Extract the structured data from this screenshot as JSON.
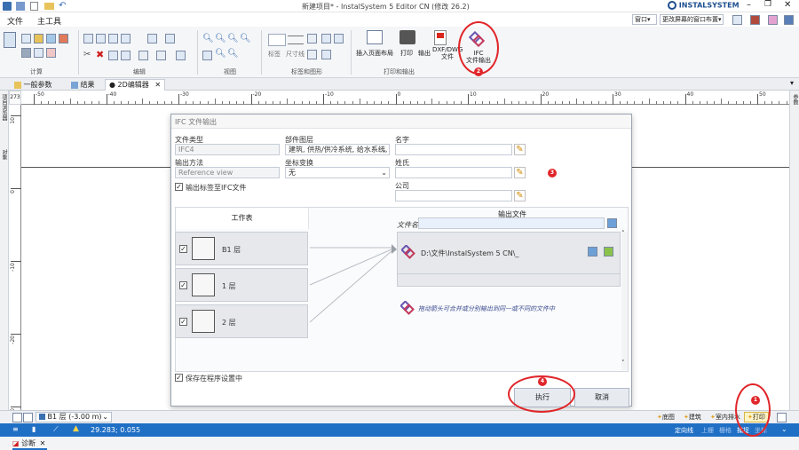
{
  "window": {
    "title": "新建项目* - InstalSystem 5 Editor CN (修改 26.2)",
    "brand": "INSTALSYSTEM"
  },
  "menu": {
    "file": "文件",
    "main_tools": "主工具"
  },
  "top_right": {
    "window": "窗口",
    "change_layout": "更改屏幕的窗口布置"
  },
  "ribbon": {
    "group_calc": "计算",
    "group_edit": "编辑",
    "group_view": "视图",
    "group_annotations": "标签和图形",
    "group_print": "打印和输出",
    "labels": "标签",
    "dims": "尺寸线",
    "insert_layout": "插入页面布局",
    "print": "打印",
    "output": "输出",
    "dxf_line1": "DXF/DWG",
    "dxf_line2": "文件",
    "ifc_line1": "IFC",
    "ifc_line2": "文件输出"
  },
  "doc_tabs": {
    "general": "一般参数",
    "results": "结果",
    "editor": "● 2D编辑器"
  },
  "ruler": {
    "ticks": [
      "-50",
      "-40",
      "-30",
      "-20",
      "-10",
      "0",
      "10",
      "20",
      "30",
      "40",
      "50"
    ],
    "corner": "273"
  },
  "vruler": {
    "ticks": [
      "10",
      "0",
      "-10",
      "-20",
      "-30"
    ]
  },
  "left_panels": {
    "p1": "项目浏览器",
    "p2": "对象"
  },
  "right_panel": {
    "p1": "参数"
  },
  "dialog": {
    "title": "IFC 文件输出",
    "file_type_label": "文件类型",
    "file_type_value": "IFC4",
    "output_method_label": "输出方法",
    "output_method_value": "Reference view",
    "component_layer_label": "部件图层",
    "component_layer_value": "建筑, 供热/供冷系统, 给水系统, 逢",
    "coord_label": "坐标变换",
    "coord_value": "无",
    "name_label": "名字",
    "surname_label": "姓氏",
    "company_label": "公司",
    "export_labels_check": "输出标签至IFC文件",
    "worksheets_header": "工作表",
    "output_file_header": "输出文件",
    "filename_label": "文件名",
    "sheets": [
      {
        "label": "B1 层"
      },
      {
        "label": "1 层"
      },
      {
        "label": "2 层"
      }
    ],
    "output_path": "D:\\文件\\InstalSystem 5 CN\\_",
    "hint": "拖动箭头可合并或分别输出到同一或不同的文件中",
    "save_settings": "保存在程序设置中",
    "execute": "执行",
    "cancel": "取消"
  },
  "bottom_bar": {
    "floor_select": "B1 层 (-3.00 m)",
    "tabs": [
      "底图",
      "建筑",
      "室内排水",
      "打印"
    ]
  },
  "status": {
    "coords": "29.283; 0.055",
    "items": [
      "定向线",
      "上栅",
      "栅格",
      "捕捉",
      "坐标"
    ]
  },
  "diagnostics_tab": "诊断",
  "annotations": [
    "1",
    "2",
    "3",
    "4"
  ]
}
